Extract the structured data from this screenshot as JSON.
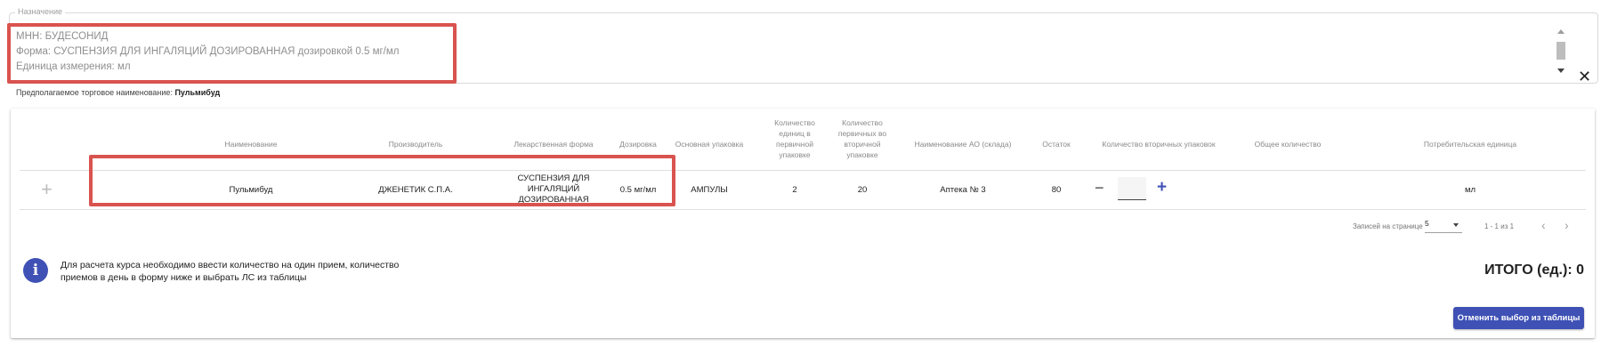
{
  "purpose": {
    "legend": "Назначение",
    "lines": [
      "МНН: БУДЕСОНИД",
      "Форма: СУСПЕНЗИЯ ДЛЯ ИНГАЛЯЦИЙ ДОЗИРОВАННАЯ дозировкой 0.5 мг/мл",
      "Единица измерения: мл"
    ],
    "clear_symbol": "✕"
  },
  "trade_name": {
    "label": "Предполагаемое торговое наименование: ",
    "value": "Пульмибуд"
  },
  "table": {
    "headers": {
      "name": "Наименование",
      "manufacturer": "Производитель",
      "form": "Лекарственная форма",
      "dosage": "Дозировка",
      "package": "Основная упаковка",
      "qty_primary_1": "Количество",
      "qty_primary_2": "единиц в",
      "qty_primary_3": "первичной",
      "qty_primary_4": "упаковке",
      "qty_secondary_1": "Количество",
      "qty_secondary_2": "первичных во",
      "qty_secondary_3": "вторичной",
      "qty_secondary_4": "упаковке",
      "pharmacy": "Наименование АО (склада)",
      "stock": "Остаток",
      "sec_count": "Количество вторичных упаковок",
      "total_qty": "Общее количество",
      "unit": "Потребительская единица"
    },
    "row": {
      "name": "Пульмибуд",
      "manufacturer": "ДЖЕНЕТИК С.П.А.",
      "form_1": "СУСПЕНЗИЯ ДЛЯ",
      "form_2": "ИНГАЛЯЦИЙ",
      "form_3": "ДОЗИРОВАННАЯ",
      "dosage": "0.5 мг/мл",
      "package": "АМПУЛЫ",
      "qty_primary": "2",
      "qty_secondary": "20",
      "pharmacy": "Аптека № 3",
      "stock": "80",
      "sec_count_value": "",
      "unit": "мл"
    }
  },
  "pager": {
    "rows_label": "Записей на странице",
    "rows_value": "5",
    "range": "1 - 1 из 1"
  },
  "info": {
    "icon": "i",
    "line_1": "Для расчета курса необходимо ввести количество на один прием, количество",
    "line_2": "приемов в день в форму ниже и выбрать ЛС из таблицы"
  },
  "total": "ИТОГО (ед.): 0",
  "cancel_button": "Отменить выбор из таблицы",
  "colors": {
    "accent": "#3f51b5",
    "highlight": "#d9534f"
  }
}
